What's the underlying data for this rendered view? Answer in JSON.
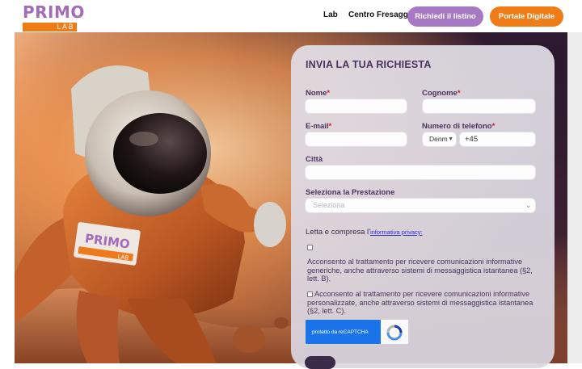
{
  "brand": {
    "name": "PRIMO",
    "sub": "LAB"
  },
  "nav": {
    "links": [
      "Lab",
      "Centro Fresaggio"
    ],
    "cta_primary": "Richiedi il listino",
    "cta_secondary": "Portale Digitale"
  },
  "form": {
    "title": "INVIA LA TUA RICHIESTA",
    "nome_label": "Nome",
    "cognome_label": "Cognome",
    "email_label": "E-mail",
    "phone_label": "Numero di telefono",
    "required_mark": "*",
    "country_value": "Denm",
    "phone_value": "+45",
    "citta_label": "Città",
    "prestazione_label": "Seleziona la Prestazione",
    "prestazione_placeholder": "Seleziona",
    "privacy_prefix": "Letta e compresa l'",
    "privacy_link": "informativa privacy:",
    "consent_1": "Acconsento al trattamento per ricevere comunicazioni informative generiche, anche attraverso sistemi di messaggistica istantanea (§2, lett. B).",
    "consent_2": "Acconsento al trattamento per ricevere comunicazioni informative personalizzate, anche attraverso sistemi di messaggistica istantanea (§2, lett. C).",
    "captcha_label": "protetto da reCAPTCHA"
  },
  "hero": {
    "badge_name": "PRIMO",
    "badge_sub": "LAB"
  },
  "colors": {
    "purple": "#a779c4",
    "orange": "#f07c17",
    "title": "#4b3360"
  }
}
